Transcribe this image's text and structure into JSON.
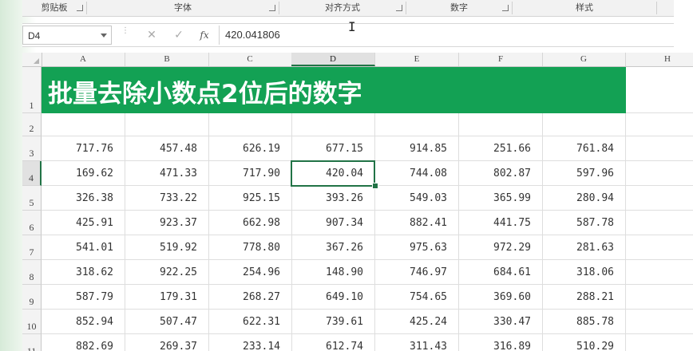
{
  "ribbon": {
    "groups": [
      "剪贴板",
      "字体",
      "对齐方式",
      "数字",
      "样式"
    ]
  },
  "formula_bar": {
    "name_box": "D4",
    "cancel_glyph": "✕",
    "enter_glyph": "✓",
    "fx_label": "fx",
    "formula": "420.041806"
  },
  "sheet": {
    "columns": [
      "A",
      "B",
      "C",
      "D",
      "E",
      "F",
      "G",
      "H"
    ],
    "selected_column": "D",
    "row_numbers": [
      "1",
      "2",
      "3",
      "4",
      "5",
      "6",
      "7",
      "8",
      "9",
      "10",
      "11"
    ],
    "selected_row": "4",
    "title": "批量去除小数点2位后的数字",
    "rows": [
      [
        "717.76",
        "457.48",
        "626.19",
        "677.15",
        "914.85",
        "251.66",
        "761.84"
      ],
      [
        "169.62",
        "471.33",
        "717.90",
        "420.04",
        "744.08",
        "802.87",
        "597.96"
      ],
      [
        "326.38",
        "733.22",
        "925.15",
        "393.26",
        "549.03",
        "365.99",
        "280.94"
      ],
      [
        "425.91",
        "923.37",
        "662.98",
        "907.34",
        "882.41",
        "441.75",
        "587.78"
      ],
      [
        "541.01",
        "519.92",
        "778.80",
        "367.26",
        "975.63",
        "972.29",
        "281.63"
      ],
      [
        "318.62",
        "922.25",
        "254.96",
        "148.90",
        "746.97",
        "684.61",
        "318.06"
      ],
      [
        "587.79",
        "179.31",
        "268.27",
        "649.10",
        "754.65",
        "369.60",
        "288.21"
      ],
      [
        "852.94",
        "507.47",
        "622.31",
        "739.61",
        "425.24",
        "330.47",
        "885.78"
      ],
      [
        "882.69",
        "269.37",
        "233.14",
        "612.74",
        "311.43",
        "316.89",
        "510.29"
      ]
    ]
  },
  "colors": {
    "banner": "#13a154",
    "selection": "#217346"
  }
}
